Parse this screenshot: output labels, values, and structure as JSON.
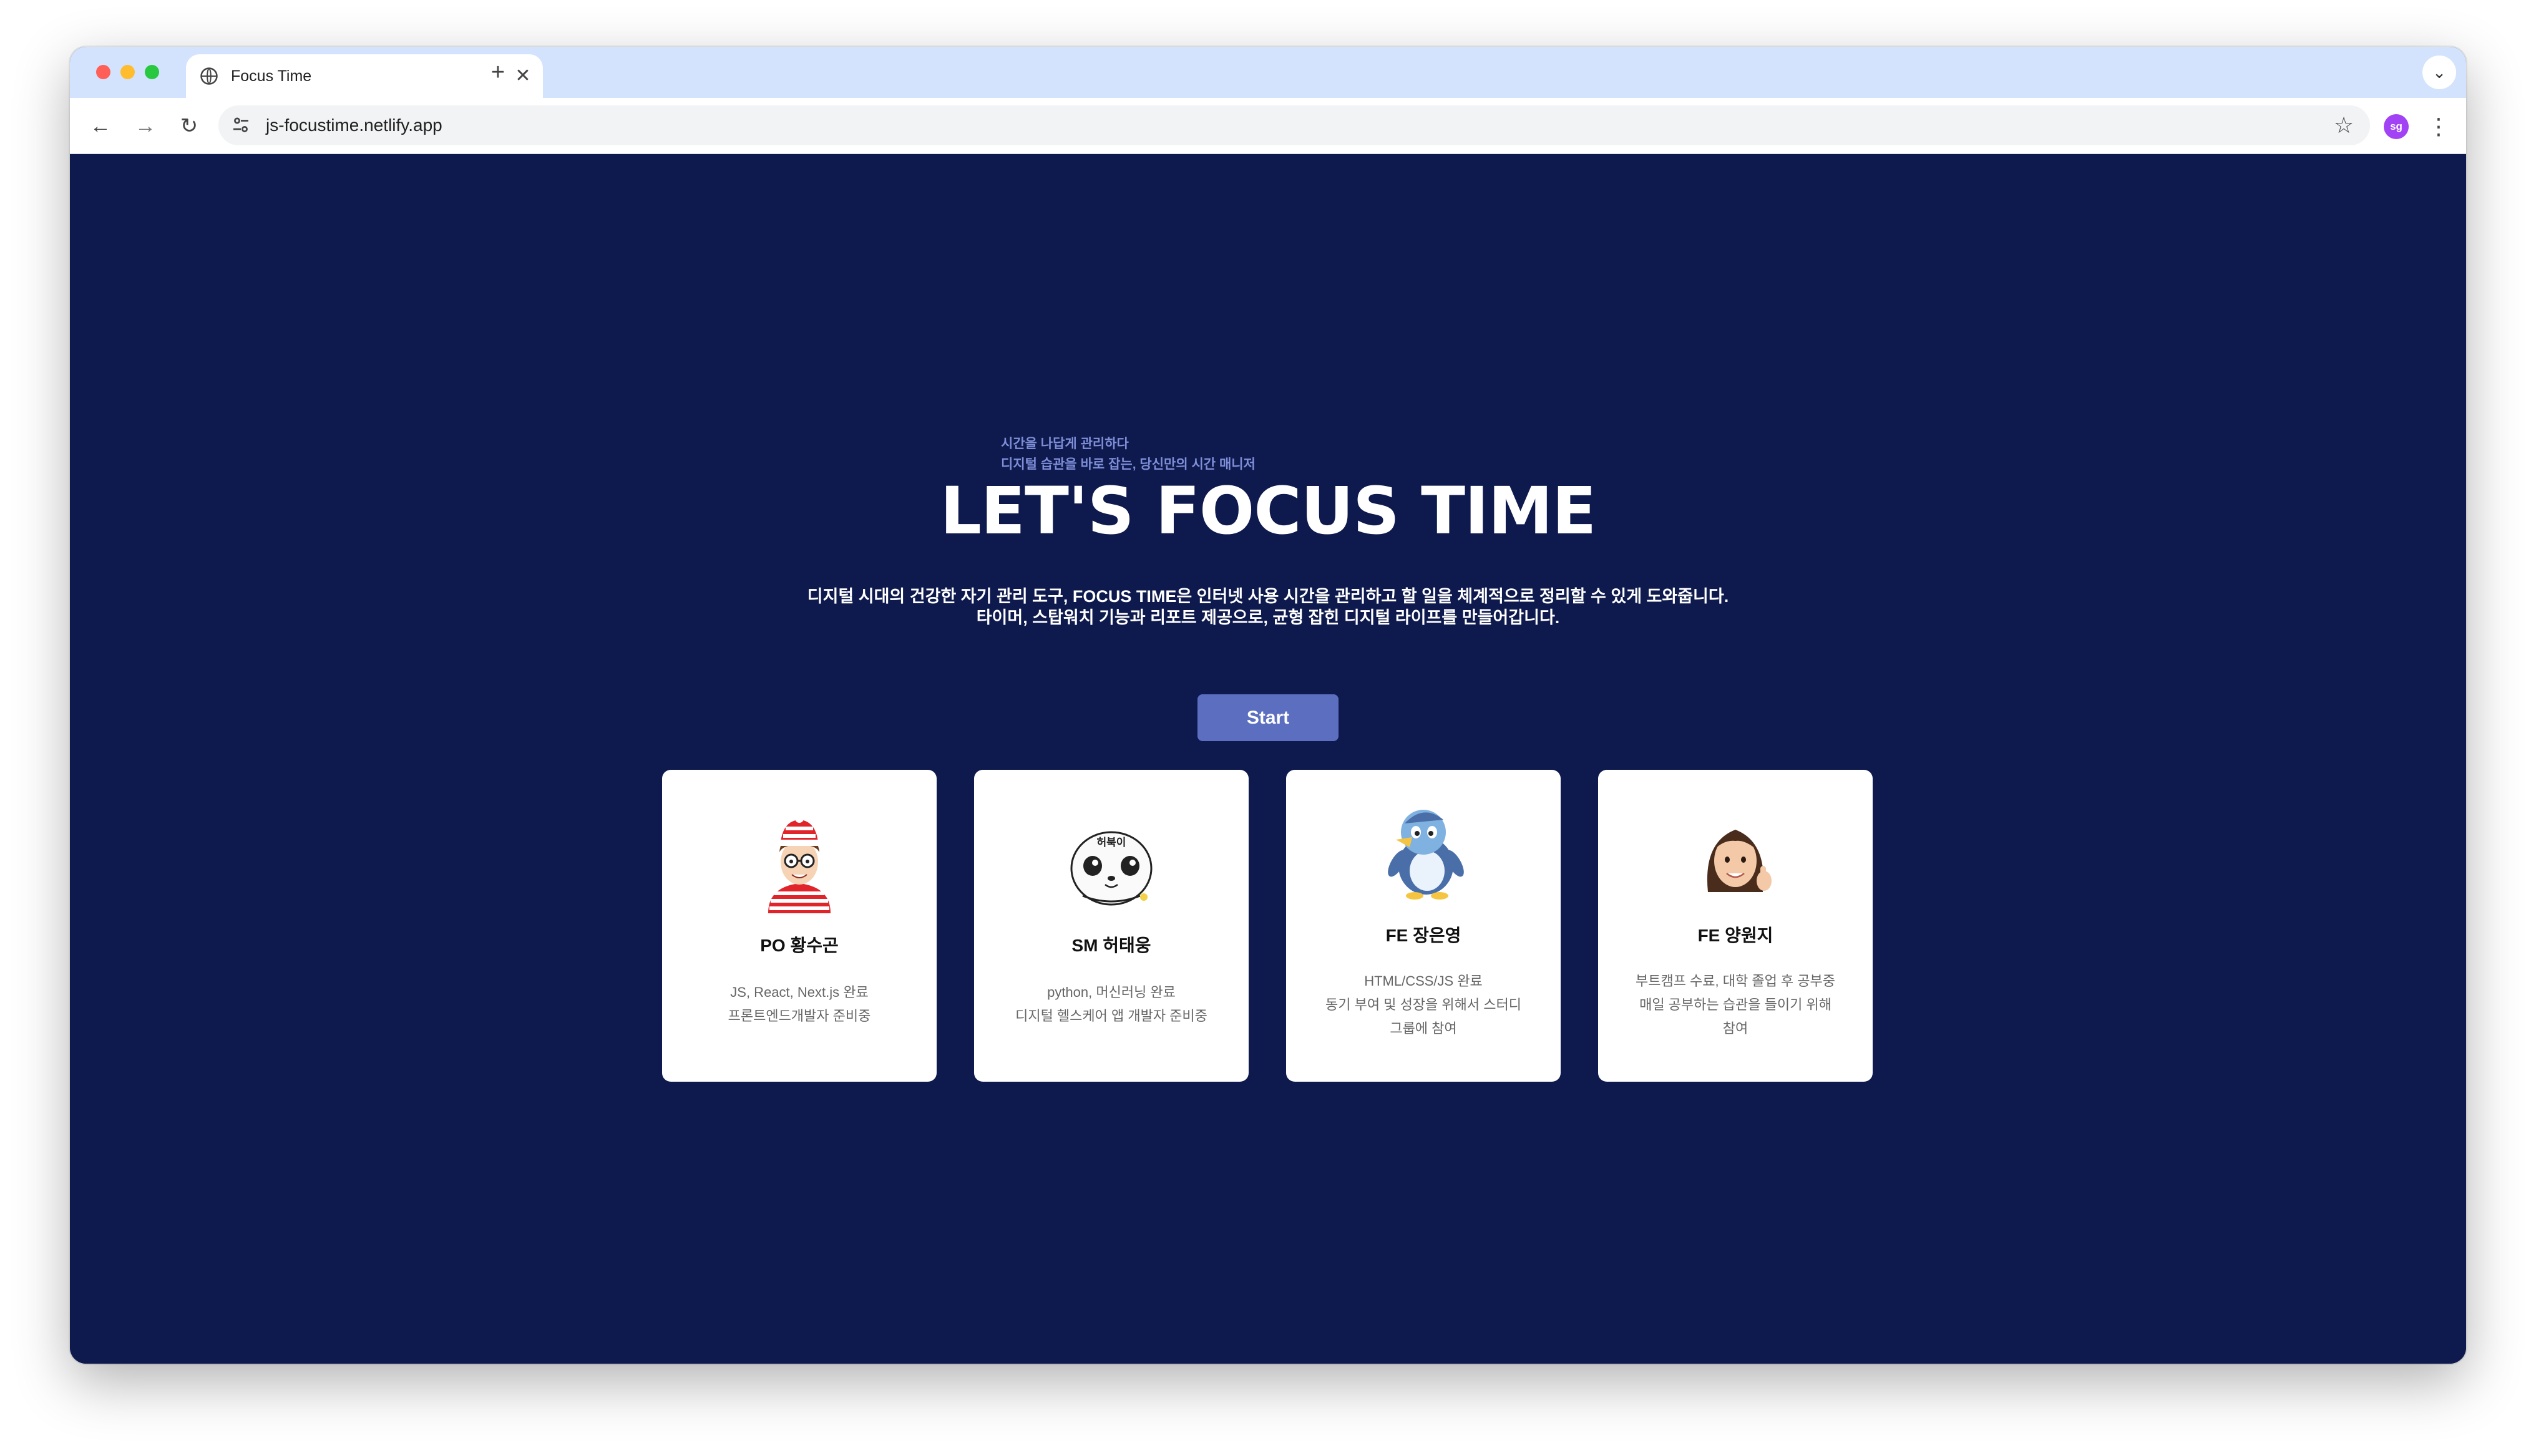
{
  "browser": {
    "tab_title": "Focus Time",
    "url": "js-focustime.netlify.app",
    "profile_initials": "sg",
    "icons": {
      "back": "arrow-left-icon",
      "forward": "arrow-right-icon",
      "reload": "reload-icon",
      "site_info": "tune-icon",
      "bookmark": "star-icon",
      "menu": "more-vert-icon",
      "new_tab": "plus-icon",
      "tab_close": "close-icon",
      "tab_list": "chevron-down-icon",
      "tab_favicon": "globe-icon"
    }
  },
  "hero": {
    "eyebrow_line1": "시간을 나답게 관리하다",
    "eyebrow_line2": "디지털 습관을 바로 잡는, 당신만의 시간 매니저",
    "title": "LET'S FOCUS TIME",
    "description_line1": "디지털 시대의 건강한 자기 관리 도구, FOCUS TIME은 인터넷 사용 시간을 관리하고 할 일을 체계적으로 정리할 수 있게 도와줍니다.",
    "description_line2": "타이머, 스탑워치 기능과 리포트 제공으로, 균형 잡힌 디지털 라이프를 만들어갑니다.",
    "start_label": "Start"
  },
  "team": [
    {
      "name": "PO 황수곤",
      "avatar": "waldo-avatar",
      "desc_lines": [
        "JS, React, Next.js 완료",
        "프론트엔드개발자 준비중"
      ]
    },
    {
      "name": "SM 허태웅",
      "avatar": "seal-character-avatar",
      "badge": "허북이",
      "desc_lines": [
        "python, 머신러닝 완료",
        "디지털 헬스케어 앱 개발자 준비중"
      ]
    },
    {
      "name": "FE 장은영",
      "avatar": "penguin-avatar",
      "desc_lines": [
        "HTML/CSS/JS 완료",
        "동기 부여 및 성장을 위해서 스터디",
        "그룹에 참여"
      ]
    },
    {
      "name": "FE 양원지",
      "avatar": "memoji-avatar",
      "desc_lines": [
        "부트캠프 수료, 대학 졸업 후 공부중",
        "매일 공부하는 습관을 들이기 위해",
        "참여"
      ]
    }
  ],
  "colors": {
    "page_background": "#0e1a4d",
    "accent_button": "#5b6ec0",
    "eyebrow_text": "#7e8ed8",
    "tabstrip": "#d3e3fd"
  }
}
